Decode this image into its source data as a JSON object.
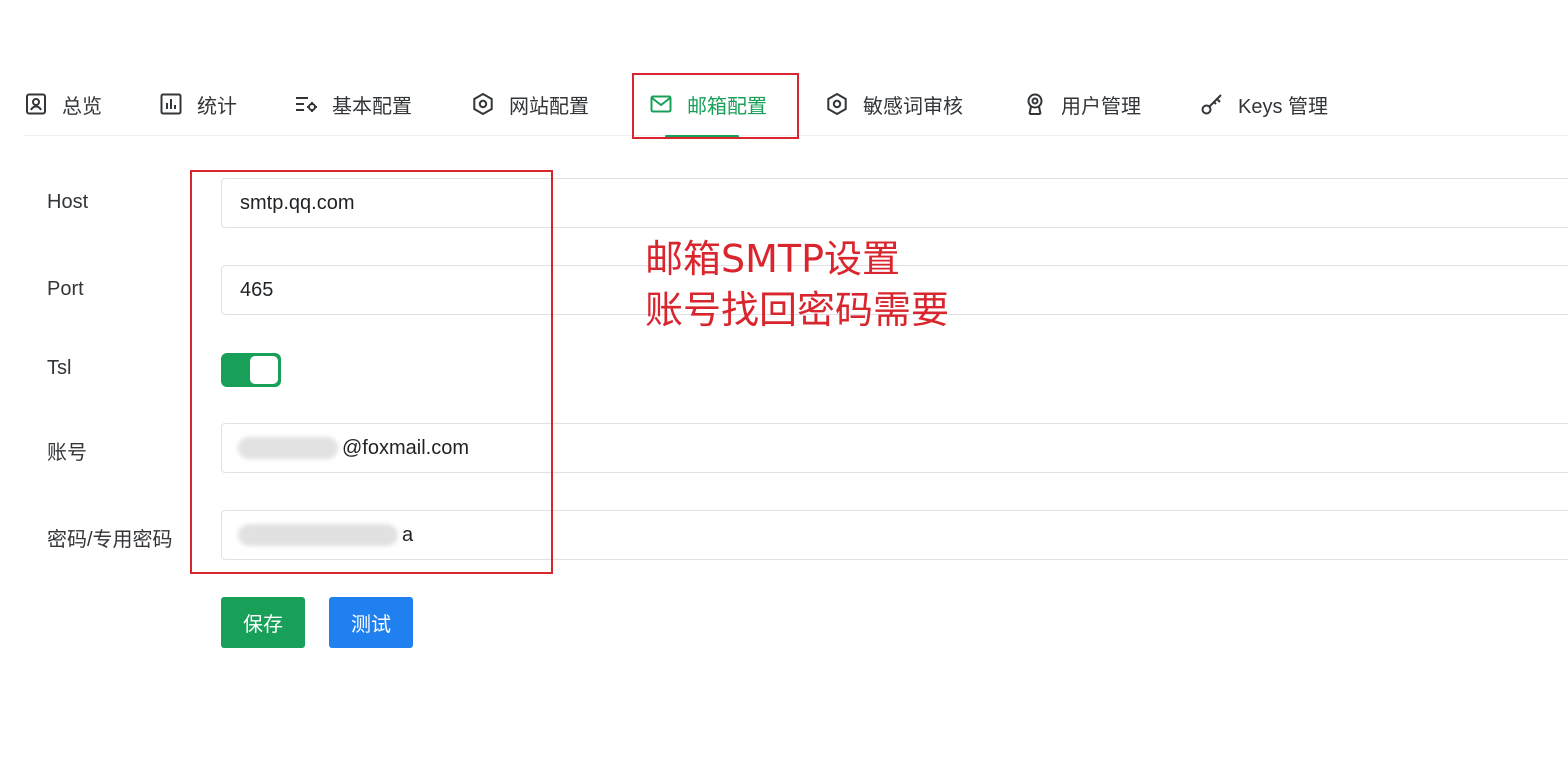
{
  "tabs": [
    {
      "label": "总览",
      "icon": "dashboard-icon",
      "active": false
    },
    {
      "label": "统计",
      "icon": "bar-chart-icon",
      "active": false
    },
    {
      "label": "基本配置",
      "icon": "settings-list-icon",
      "active": false
    },
    {
      "label": "网站配置",
      "icon": "hexagon-icon",
      "active": false
    },
    {
      "label": "邮箱配置",
      "icon": "mail-icon",
      "active": true
    },
    {
      "label": "敏感词审核",
      "icon": "hexagon-icon",
      "active": false
    },
    {
      "label": "用户管理",
      "icon": "user-badge-icon",
      "active": false
    },
    {
      "label": "Keys 管理",
      "icon": "key-icon",
      "active": false
    }
  ],
  "form": {
    "host": {
      "label": "Host",
      "value": "smtp.qq.com"
    },
    "port": {
      "label": "Port",
      "value": "465"
    },
    "tsl": {
      "label": "Tsl",
      "enabled": true
    },
    "account": {
      "label": "账号",
      "value": "@foxmail.com"
    },
    "password": {
      "label": "密码/专用密码",
      "value": "a"
    }
  },
  "buttons": {
    "save": "保存",
    "test": "测试"
  },
  "annotation": {
    "line1": "邮箱SMTP设置",
    "line2": "账号找回密码需要"
  },
  "colors": {
    "primary": "#18a058",
    "info": "#2080f0",
    "annotation": "#d9262e"
  }
}
